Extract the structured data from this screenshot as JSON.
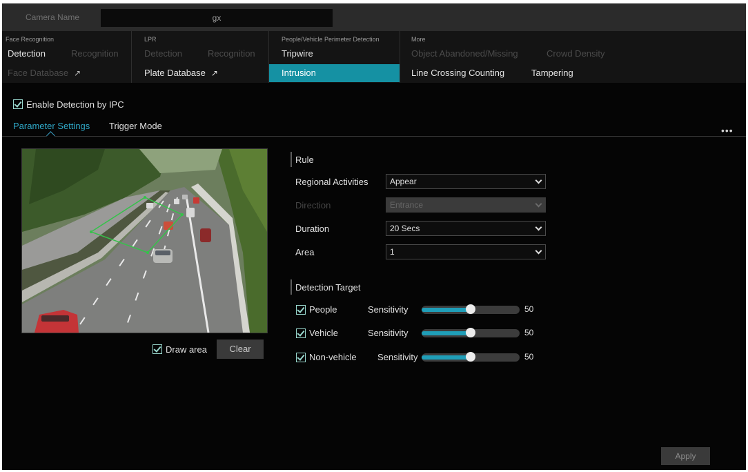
{
  "camera": {
    "label": "Camera Name",
    "value": "gx"
  },
  "menu": {
    "face_recognition": {
      "title": "Face Recognition",
      "detection": "Detection",
      "recognition": "Recognition",
      "face_database": "Face Database"
    },
    "lpr": {
      "title": "LPR",
      "detection": "Detection",
      "recognition": "Recognition",
      "plate_database": "Plate Database"
    },
    "pvpd": {
      "title": "People/Vehicle Perimeter Detection",
      "tripwire": "Tripwire",
      "intrusion": "Intrusion"
    },
    "more": {
      "title": "More",
      "object_abandoned": "Object Abandoned/Missing",
      "crowd_density": "Crowd Density",
      "line_crossing": "Line Crossing Counting",
      "tampering": "Tampering"
    },
    "arrow_glyph": "↗"
  },
  "enable_detection": {
    "label": "Enable Detection by IPC",
    "checked": true
  },
  "tabs": [
    {
      "label": "Parameter Settings",
      "active": true
    },
    {
      "label": "Trigger Mode",
      "active": false
    }
  ],
  "more_glyph": "•••",
  "draw_area": {
    "label": "Draw area",
    "checked": true
  },
  "clear_label": "Clear",
  "rule": {
    "title": "Rule",
    "regional_activities": {
      "label": "Regional Activities",
      "value": "Appear"
    },
    "direction": {
      "label": "Direction",
      "value": "Entrance",
      "disabled": true
    },
    "duration": {
      "label": "Duration",
      "value": "20 Secs"
    },
    "area": {
      "label": "Area",
      "value": "1"
    }
  },
  "detection_target": {
    "title": "Detection Target",
    "sensitivity_label": "Sensitivity",
    "items": [
      {
        "label": "People",
        "checked": true,
        "value": "50",
        "level": 50
      },
      {
        "label": "Vehicle",
        "checked": true,
        "value": "50",
        "level": 50
      },
      {
        "label": "Non-vehicle",
        "checked": true,
        "value": "50",
        "level": 50
      }
    ]
  },
  "apply_label": "Apply",
  "colors": {
    "accent": "#1591a3",
    "slider_fill": "#1f9eb8",
    "tab_active": "#2fa7c6",
    "checkbox": "#9ad9cf"
  }
}
